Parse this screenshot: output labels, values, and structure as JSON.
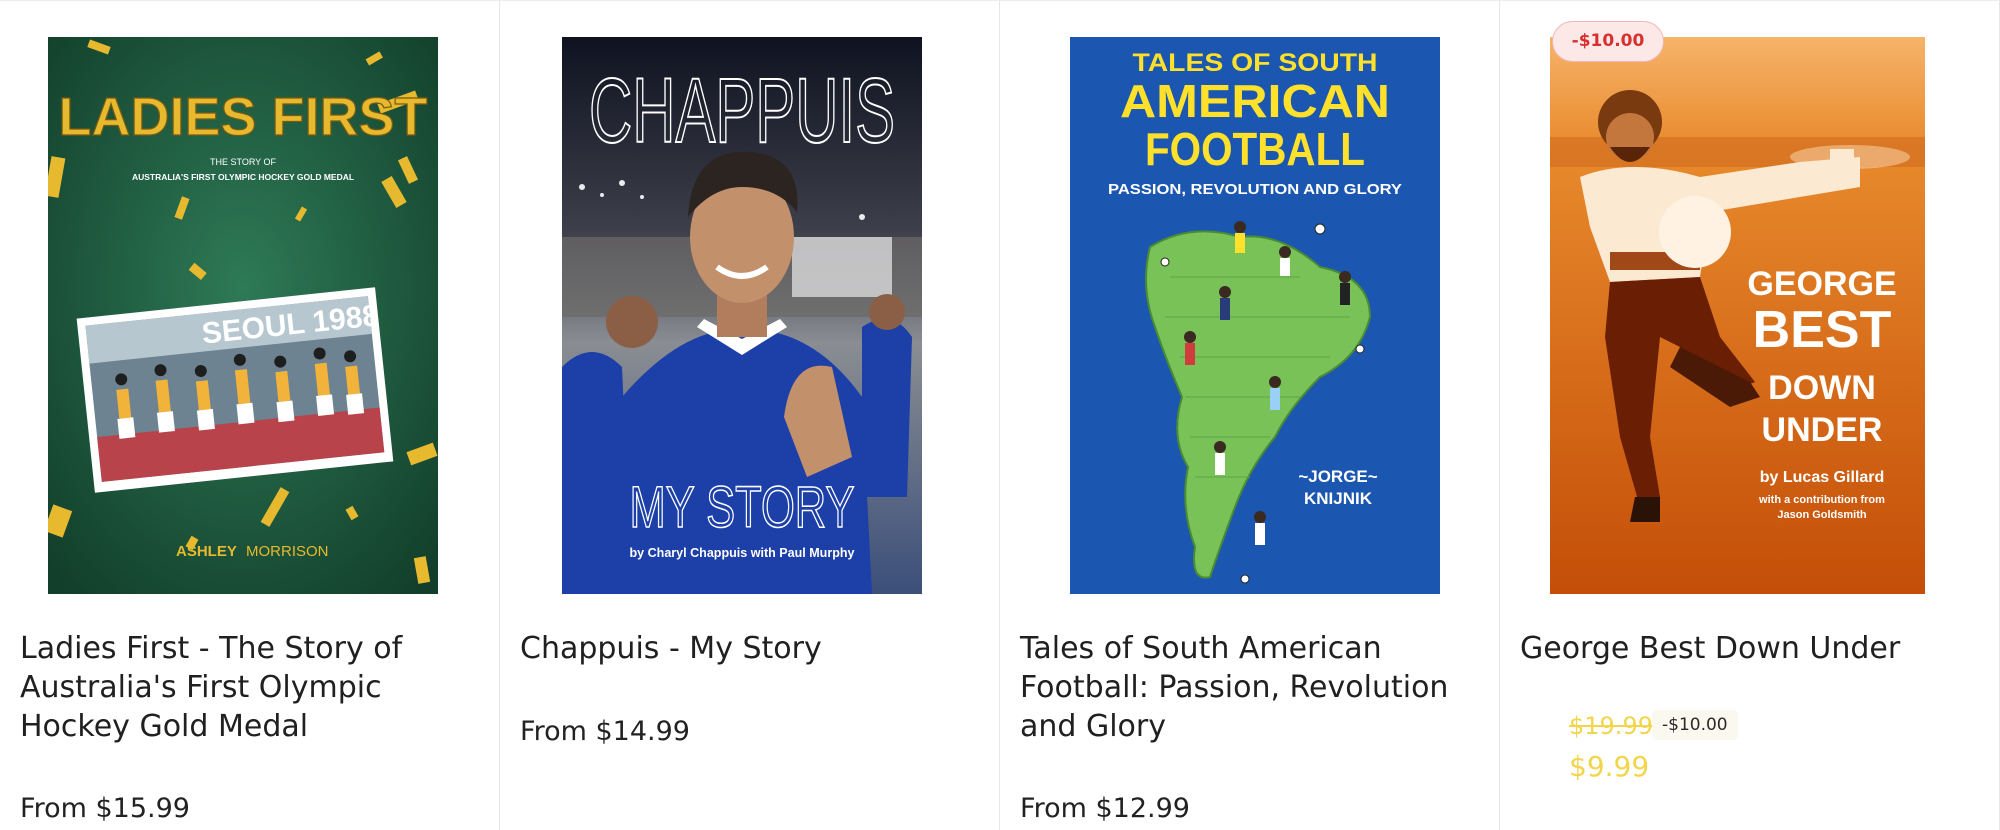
{
  "products": [
    {
      "title": "Ladies First - The Story of Australia's First Olympic Hockey Gold Medal",
      "price": "From $15.99",
      "cover": {
        "main_title": "LADIES FIRST",
        "kicker": "THE STORY OF",
        "subtitle": "AUSTRALIA'S FIRST OLYMPIC HOCKEY GOLD MEDAL",
        "photo_caption": "SEOUL 1988",
        "author_first": "ASHLEY",
        "author_last": "MORRISON",
        "bg": "#1c5a3f",
        "gold": "#e7b92f"
      }
    },
    {
      "title": "Chappuis - My Story",
      "price": "From $14.99",
      "cover": {
        "main_title": "CHAPPUIS",
        "sub_title": "MY STORY",
        "byline": "by Charyl Chappuis with Paul Murphy",
        "jersey": "#1c3fa8"
      }
    },
    {
      "title": "Tales of South American Football: Passion, Revolution and Glory",
      "price": "From $12.99",
      "cover": {
        "line1": "TALES OF SOUTH",
        "line2": "AMERICAN",
        "line3": "FOOTBALL",
        "tagline": "PASSION, REVOLUTION AND GLORY",
        "author1": "~JORGE~",
        "author2": "KNIJNIK",
        "bg": "#1b56b0",
        "yellow": "#ffe02a",
        "map": "#78c258"
      }
    },
    {
      "title": "George Best Down Under",
      "badge": "-$10.00",
      "old_price": "$19.99",
      "save_chip": "-$10.00",
      "new_price": "$9.99",
      "cover": {
        "line1": "GEORGE",
        "line2": "BEST",
        "line3": "DOWN",
        "line4": "UNDER",
        "byline": "by Lucas Gillard",
        "contrib1": "with a contribution from",
        "contrib2": "Jason Goldsmith",
        "bg": "#e06a10"
      }
    }
  ],
  "colors": {
    "sale_price": "#f2d54b",
    "badge_text": "#d8302f",
    "badge_bg": "#fde8e8"
  }
}
